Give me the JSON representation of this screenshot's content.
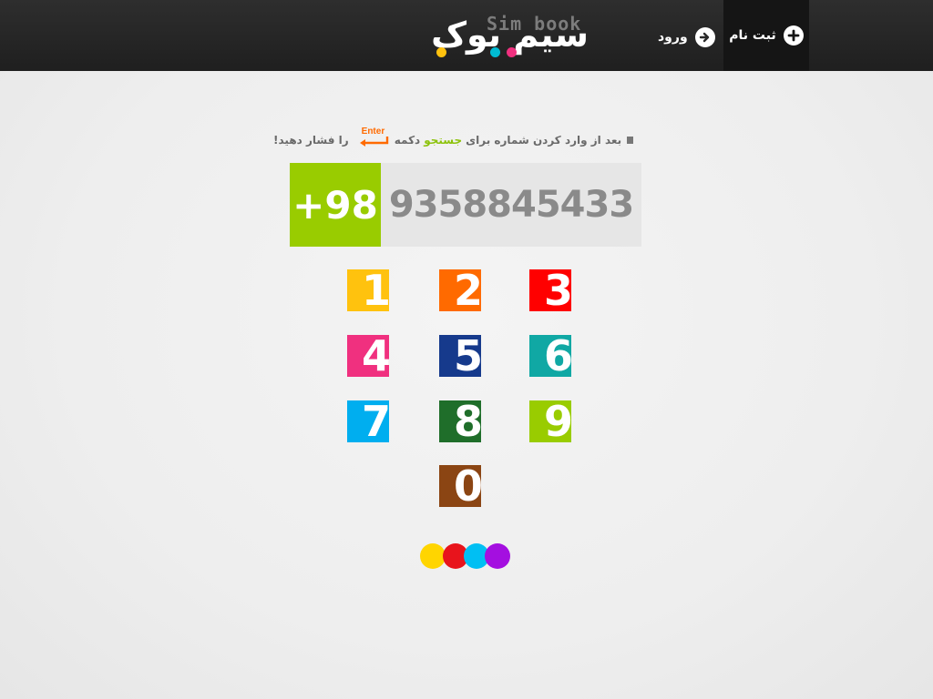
{
  "header": {
    "logo_farsi": "سیم بوک",
    "logo_latin": "Sim book",
    "login_label": "ورود",
    "register_label": "ثبت نام"
  },
  "hint": {
    "part1": "بعد از وارد کردن شماره برای",
    "highlight": "جستجو",
    "part2": "دکمه",
    "enter_key": "Enter",
    "part3": "را فشار دهید!"
  },
  "phone": {
    "prefix": "+98",
    "number": "9358845433"
  },
  "keypad": {
    "keys": [
      {
        "label": "1",
        "color": "#ffc20e"
      },
      {
        "label": "2",
        "color": "#ff6a00"
      },
      {
        "label": "3",
        "color": "#ff0000"
      },
      {
        "label": "4",
        "color": "#f0307f"
      },
      {
        "label": "5",
        "color": "#163a8c"
      },
      {
        "label": "6",
        "color": "#10a8a4"
      },
      {
        "label": "7",
        "color": "#00aeef"
      },
      {
        "label": "8",
        "color": "#1f6e2a"
      },
      {
        "label": "9",
        "color": "#99cc00"
      },
      {
        "label": "0",
        "color": "#8b4513"
      }
    ]
  },
  "dots": {
    "colors": [
      "#ffd500",
      "#e8141c",
      "#00bff3",
      "#a40fe0"
    ]
  },
  "colors": {
    "header_bg": "#262626",
    "accent_green": "#99cc00",
    "enter_orange": "#ff6a00"
  }
}
